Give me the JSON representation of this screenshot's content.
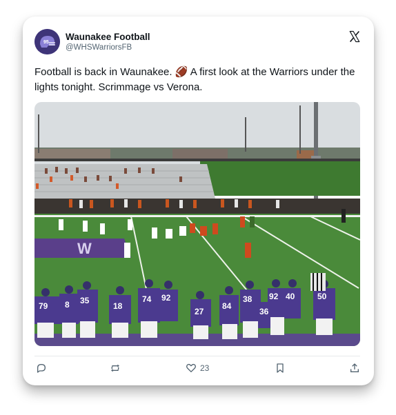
{
  "post": {
    "author_name": "Waunakee Football",
    "author_handle": "@WHSWarriorsFB",
    "text": "Football is back in Waunakee. 🏈 A first look at the Warriors under the lights tonight. Scrimmage vs Verona.",
    "likes": "23"
  },
  "icons": {
    "platform": "x-logo-icon",
    "reply": "reply-icon",
    "repost": "repost-icon",
    "like": "heart-icon",
    "bookmark": "bookmark-icon",
    "share": "share-icon"
  },
  "photo": {
    "jersey_numbers": [
      "79",
      "8",
      "35",
      "18",
      "74",
      "92",
      "27",
      "84",
      "38",
      "36",
      "92",
      "40",
      "50"
    ],
    "field_marking": "W"
  },
  "colors": {
    "text": "#0f1419",
    "secondary_text": "#536471",
    "avatar_purple": "#4a3c8c",
    "jersey_purple": "#4b3a8f",
    "field_green": "#4a8a3a"
  }
}
